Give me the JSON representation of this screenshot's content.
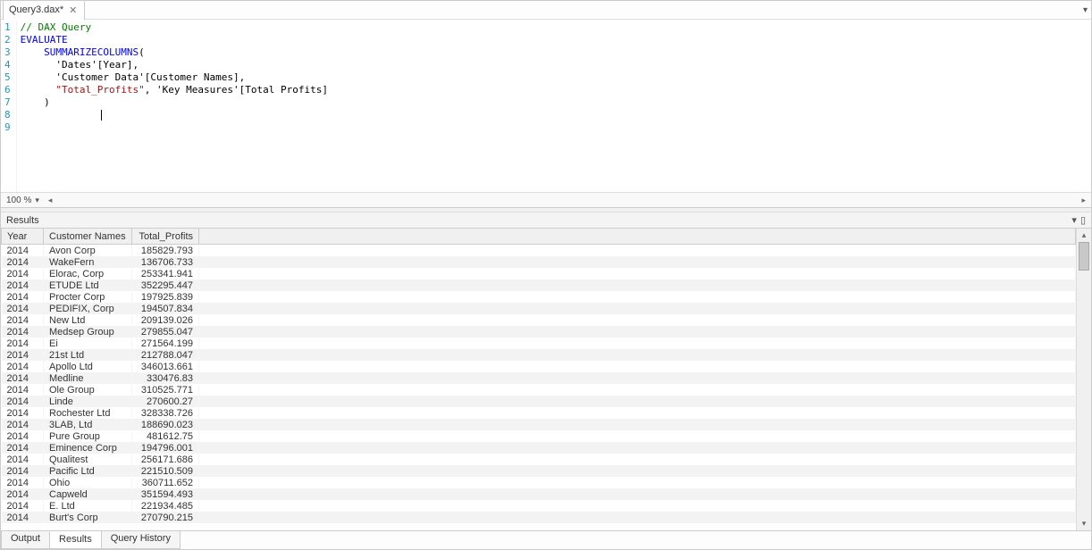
{
  "tab": {
    "title": "Query3.dax*"
  },
  "editor": {
    "zoom": "100 %",
    "lines": [
      {
        "n": 1,
        "tokens": [
          {
            "cls": "tok-comment",
            "t": "// DAX Query"
          }
        ]
      },
      {
        "n": 2,
        "tokens": [
          {
            "cls": "tok-kw",
            "t": "EVALUATE"
          }
        ]
      },
      {
        "n": 3,
        "tokens": [
          {
            "cls": "tok-plain",
            "t": "    "
          },
          {
            "cls": "tok-func",
            "t": "SUMMARIZECOLUMNS"
          },
          {
            "cls": "tok-plain",
            "t": "("
          }
        ]
      },
      {
        "n": 4,
        "tokens": [
          {
            "cls": "tok-plain",
            "t": "      'Dates'[Year],"
          }
        ]
      },
      {
        "n": 5,
        "tokens": [
          {
            "cls": "tok-plain",
            "t": "      'Customer Data'[Customer Names],"
          }
        ]
      },
      {
        "n": 6,
        "tokens": [
          {
            "cls": "tok-plain",
            "t": "      "
          },
          {
            "cls": "tok-str",
            "t": "\"Total_Profits\""
          },
          {
            "cls": "tok-plain",
            "t": ", 'Key Measures'[Total Profits]"
          }
        ]
      },
      {
        "n": 7,
        "tokens": [
          {
            "cls": "tok-plain",
            "t": "    )"
          }
        ]
      },
      {
        "n": 8,
        "tokens": [
          {
            "cls": "tok-plain",
            "t": ""
          }
        ]
      },
      {
        "n": 9,
        "tokens": [
          {
            "cls": "tok-plain",
            "t": ""
          }
        ]
      }
    ]
  },
  "results": {
    "panel_title": "Results",
    "columns": [
      {
        "key": "year",
        "label": "Year"
      },
      {
        "key": "name",
        "label": "Customer Names"
      },
      {
        "key": "profit",
        "label": "Total_Profits"
      }
    ],
    "rows": [
      {
        "year": "2014",
        "name": "Avon Corp",
        "profit": "185829.793"
      },
      {
        "year": "2014",
        "name": "WakeFern",
        "profit": "136706.733"
      },
      {
        "year": "2014",
        "name": "Elorac, Corp",
        "profit": "253341.941"
      },
      {
        "year": "2014",
        "name": "ETUDE Ltd",
        "profit": "352295.447"
      },
      {
        "year": "2014",
        "name": "Procter Corp",
        "profit": "197925.839"
      },
      {
        "year": "2014",
        "name": "PEDIFIX, Corp",
        "profit": "194507.834"
      },
      {
        "year": "2014",
        "name": "New Ltd",
        "profit": "209139.026"
      },
      {
        "year": "2014",
        "name": "Medsep Group",
        "profit": "279855.047"
      },
      {
        "year": "2014",
        "name": "Ei",
        "profit": "271564.199"
      },
      {
        "year": "2014",
        "name": "21st Ltd",
        "profit": "212788.047"
      },
      {
        "year": "2014",
        "name": "Apollo Ltd",
        "profit": "346013.661"
      },
      {
        "year": "2014",
        "name": "Medline",
        "profit": "330476.83"
      },
      {
        "year": "2014",
        "name": "Ole Group",
        "profit": "310525.771"
      },
      {
        "year": "2014",
        "name": "Linde",
        "profit": "270600.27"
      },
      {
        "year": "2014",
        "name": "Rochester Ltd",
        "profit": "328338.726"
      },
      {
        "year": "2014",
        "name": "3LAB, Ltd",
        "profit": "188690.023"
      },
      {
        "year": "2014",
        "name": "Pure Group",
        "profit": "481612.75"
      },
      {
        "year": "2014",
        "name": "Eminence Corp",
        "profit": "194796.001"
      },
      {
        "year": "2014",
        "name": "Qualitest",
        "profit": "256171.686"
      },
      {
        "year": "2014",
        "name": "Pacific Ltd",
        "profit": "221510.509"
      },
      {
        "year": "2014",
        "name": "Ohio",
        "profit": "360711.652"
      },
      {
        "year": "2014",
        "name": "Capweld",
        "profit": "351594.493"
      },
      {
        "year": "2014",
        "name": "E. Ltd",
        "profit": "221934.485"
      },
      {
        "year": "2014",
        "name": "Burt's Corp",
        "profit": "270790.215"
      }
    ]
  },
  "bottom_tabs": {
    "output": "Output",
    "results": "Results",
    "history": "Query History"
  }
}
